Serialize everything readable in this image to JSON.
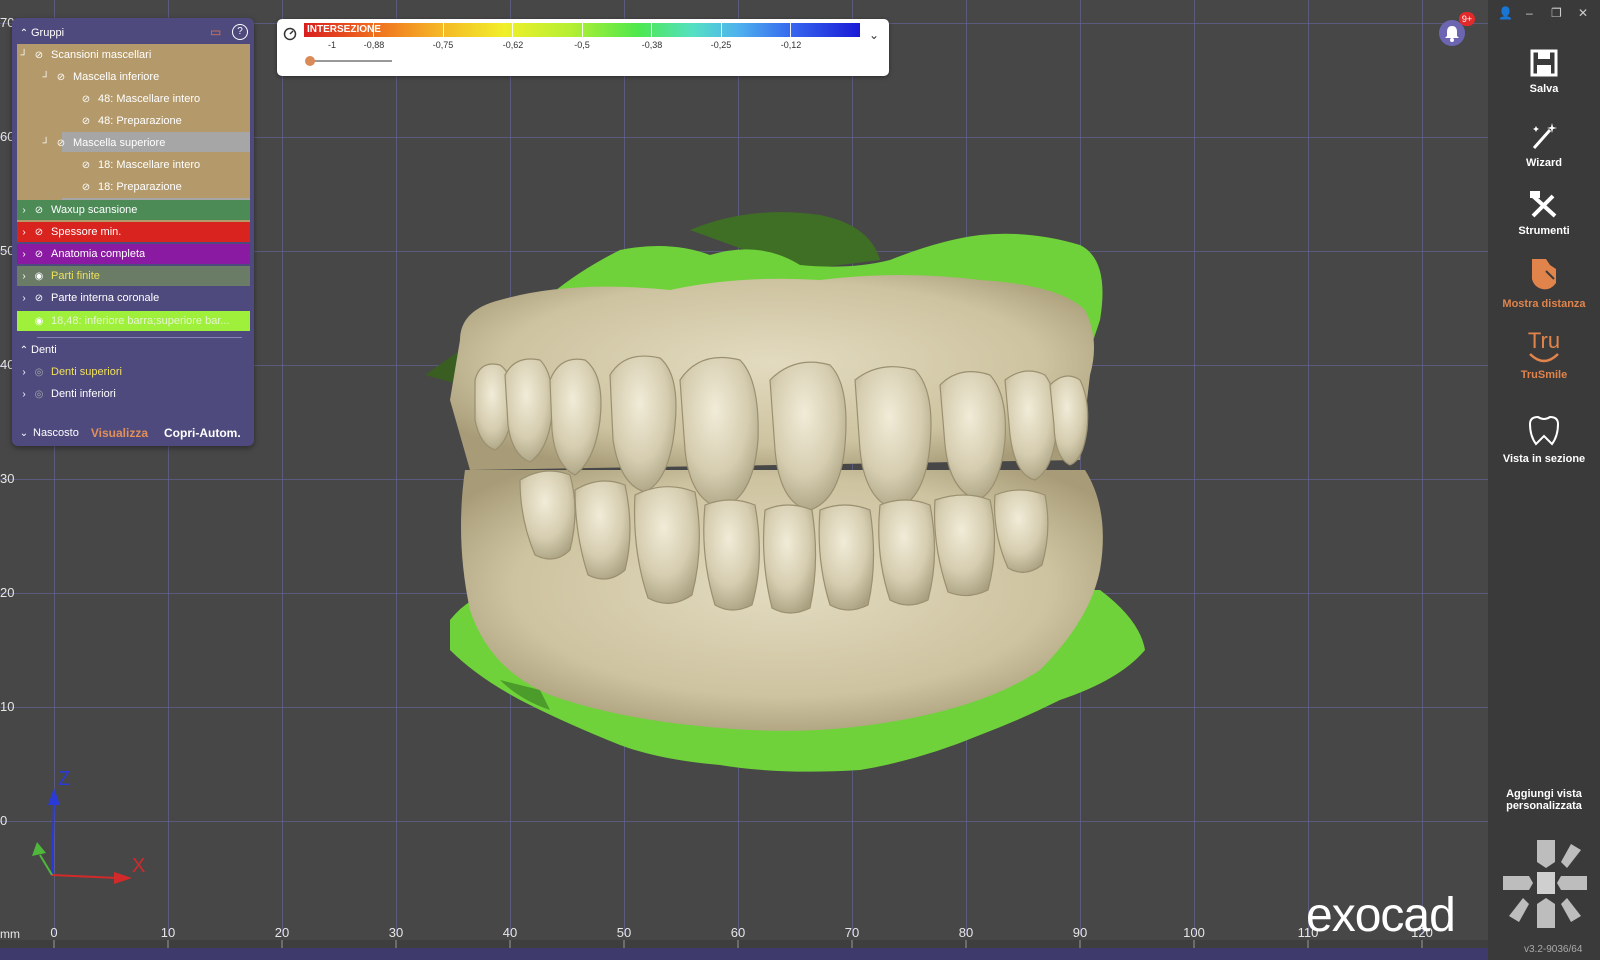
{
  "viewport": {
    "y_ticks": [
      "70",
      "60",
      "50",
      "40",
      "30",
      "20",
      "10",
      "0"
    ],
    "x_ticks": [
      "0",
      "10",
      "20",
      "30",
      "40",
      "50",
      "60",
      "70",
      "80",
      "90",
      "100",
      "110",
      "120"
    ],
    "unit": "mm",
    "axes": {
      "z": "Z",
      "x": "X"
    }
  },
  "layers_panel": {
    "groups_header": "Gruppi",
    "items": [
      {
        "label": "Scansioni mascellari",
        "visible": false
      },
      {
        "label": "Mascella inferiore",
        "visible": false
      },
      {
        "label": "48: Mascellare intero",
        "visible": false
      },
      {
        "label": "48: Preparazione",
        "visible": false
      },
      {
        "label": "Mascella superiore",
        "visible": false
      },
      {
        "label": "18: Mascellare intero",
        "visible": false
      },
      {
        "label": "18: Preparazione",
        "visible": false
      },
      {
        "label": "Waxup scansione",
        "visible": false
      },
      {
        "label": "Spessore min.",
        "visible": false
      },
      {
        "label": "Anatomia completa",
        "visible": false
      },
      {
        "label": "Parti finite",
        "visible": true
      },
      {
        "label": "Parte interna coronale",
        "visible": false
      },
      {
        "label": "18,48: inferiore barra;superiore bar...",
        "visible": true
      }
    ],
    "teeth_header": "Denti",
    "teeth": [
      {
        "label": "Denti superiori"
      },
      {
        "label": "Denti inferiori"
      }
    ],
    "footer": {
      "hidden": "Nascosto",
      "show": "Visualizza",
      "autohide": "Copri-Autom."
    },
    "colors": {
      "group_bg": "#b49a6a",
      "selected_bg": "#a6a6a6",
      "waxup": "#4c8a56",
      "spessore": "#d9231e",
      "anatomia": "#8b1aa2",
      "parti": "#6a7b66",
      "parti_text": "#f0e05a",
      "bar": "#9ef03a",
      "denti_sup_text": "#f0e05a"
    }
  },
  "colorbar": {
    "title": "INTERSEZIONE",
    "ticks": [
      "-1",
      "-0,88",
      "-0,75",
      "-0,62",
      "-0,5",
      "-0,38",
      "-0,25",
      "-0,12"
    ],
    "slider_value": "-1"
  },
  "toolbar": {
    "save": "Salva",
    "wizard": "Wizard",
    "tools": "Strumenti",
    "distance": "Mostra distanza",
    "trusmile": "TruSmile",
    "section": "Vista in sezione",
    "custom_view": "Aggiungi vista personalizzata",
    "trusmile_logo": "Tru"
  },
  "notification_badge": "9+",
  "logo": "exocad",
  "version": "v3.2-9036/64"
}
